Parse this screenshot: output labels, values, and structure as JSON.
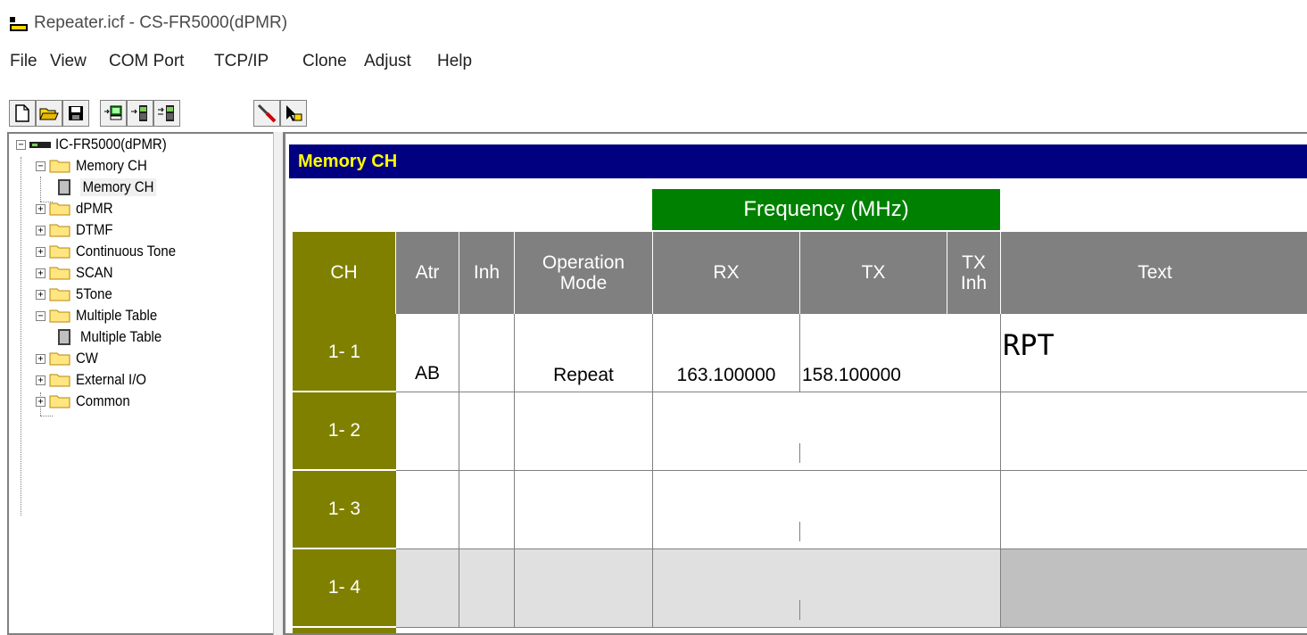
{
  "window": {
    "title": "Repeater.icf - CS-FR5000(dPMR)"
  },
  "menu": [
    "File",
    "View",
    "COM Port",
    "TCP/IP",
    "Clone",
    "Adjust",
    "Help"
  ],
  "toolbar": {
    "buttons": [
      "new-file-icon",
      "open-folder-icon",
      "save-icon",
      "read-from-radio-icon",
      "write-to-radio-icon",
      "clone-radio-icon",
      "adjust-tool-icon",
      "help-pointer-icon"
    ]
  },
  "tree": {
    "root": "IC-FR5000(dPMR)",
    "items": [
      {
        "label": "Memory CH",
        "expanded": true,
        "child": "Memory CH"
      },
      {
        "label": "dPMR"
      },
      {
        "label": "DTMF"
      },
      {
        "label": "Continuous Tone"
      },
      {
        "label": "SCAN"
      },
      {
        "label": "5Tone"
      },
      {
        "label": "Multiple Table",
        "expanded": true,
        "child": "Multiple Table"
      },
      {
        "label": "CW"
      },
      {
        "label": "External I/O"
      },
      {
        "label": "Common"
      }
    ]
  },
  "panel": {
    "title": "Memory CH",
    "group_header": "Frequency (MHz)",
    "columns": {
      "ch": "CH",
      "atr": "Atr",
      "inh": "Inh",
      "op_line1": "Operation",
      "op_line2": "Mode",
      "rx": "RX",
      "tx": "TX",
      "txinh_line1": "TX",
      "txinh_line2": "Inh",
      "text": "Text"
    },
    "rows": [
      {
        "ch": "1- 1",
        "atr": "AB",
        "inh": "",
        "mode": "Repeat",
        "rx": "163.100000",
        "tx": "158.100000",
        "txinh": "",
        "text": "RPT"
      },
      {
        "ch": "1- 2",
        "atr": "",
        "inh": "",
        "mode": "",
        "rx": "",
        "tx": "",
        "txinh": "",
        "text": ""
      },
      {
        "ch": "1- 3",
        "atr": "",
        "inh": "",
        "mode": "",
        "rx": "",
        "tx": "",
        "txinh": "",
        "text": ""
      },
      {
        "ch": "1- 4",
        "atr": "",
        "inh": "",
        "mode": "",
        "rx": "",
        "tx": "",
        "txinh": "",
        "text": ""
      }
    ]
  },
  "colors": {
    "title_bg": "#000080",
    "title_fg": "#ffff00",
    "ch_bg": "#808000",
    "header_bg": "#808080",
    "freq_bg": "#008000"
  }
}
